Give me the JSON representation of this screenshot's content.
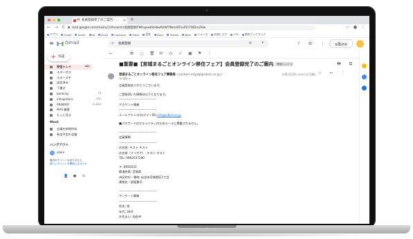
{
  "device": {
    "brand": "MacBook"
  },
  "browser": {
    "tab_title": "M: 会員登録完了のご案内 - ...",
    "tab_close": "×",
    "new_tab": "+",
    "nav_icons": "← → C",
    "url": "mail.google.com/mail/u/1/#search/会員登録/FMfcgxwKkHbwRhWTfNmzRFkxPZrTWDmZHw",
    "addr_icons": "☆ ● ⋮",
    "bookmarks": [
      "アプリ",
      "Gmail",
      "Gmail",
      "tw",
      "Drive",
      "Calendar",
      "Slack",
      "会社",
      "Docs",
      "Sheets",
      "Note",
      "ニュース",
      "お気に入り",
      "メモ",
      "他のブックマーク"
    ]
  },
  "gmail": {
    "menu_icon": "≡",
    "app_name": "Gmail",
    "search_value": "会員登録",
    "search_clear": "×",
    "search_options": "▾",
    "header_icons": "? ⚙ ⋮⋮⋮",
    "account": "sibire"
  },
  "sidebar": {
    "compose_label": "作成",
    "items": [
      {
        "label": "受信トレイ",
        "count": "481",
        "active": true
      },
      {
        "label": "スター付き",
        "count": ""
      },
      {
        "label": "スヌーズ中",
        "count": ""
      },
      {
        "label": "送信済み",
        "count": ""
      },
      {
        "label": "下書き",
        "count": ""
      },
      {
        "label": "banking",
        "count": "79"
      },
      {
        "label": "info@sibire",
        "count": "231"
      },
      {
        "label": "PRIMARY",
        "count": "11,624"
      },
      {
        "label": "MAS 顧客",
        "count": ""
      },
      {
        "label": "もっと見る",
        "count": ""
      }
    ],
    "meet_header": "Meet",
    "meet_items": [
      "会議を新規作成",
      "参加予定の会議"
    ],
    "hangouts_header": "ハングアウト",
    "hangouts_user": "sibire",
    "hangouts_note": "最近のチャットはありません",
    "hangouts_link": "新しいチャットを開始しませんか",
    "footer_icons": "👤 ● ☏"
  },
  "message": {
    "toolbar_icons": [
      "←",
      "⊠",
      "ⓘ",
      "🗑",
      "✉",
      "◷",
      "✓",
      "▣",
      "⚑",
      "⋮"
    ],
    "subject": "■重要■【宮城まるごとオンライン移住フェア】会員登録完了のご案内",
    "label_chip": "受信トレイ ×",
    "subject_icons": "🖶 ⧉",
    "sender_name": "宮城まるごとオンライン移住フェア事務局",
    "sender_email": "<system-miyagi@sibire.co.jp>",
    "to": "To 自分 ▾",
    "date": "12月7日(月) 14:02 (2 日前)",
    "date_icons": "☆ ↩ ⋮",
    "body_lines": [
      "会員登録ありがとうございます。",
      "",
      "ご登録頂いた情報は以下となります。",
      "------------------------------------",
      "アカウント情報",
      "------------------------------------",
      "メールアドレス(ログインID):",
      "",
      "■パスワードはセキュリティのためメールに掲載されません。",
      "",
      "------------------------------------",
      "会員情報",
      "------------------------------------",
      "お名前: テスト テスト",
      "お名前（フリガナ）: テスト テスト",
      "TEL: 0802037280",
      "",
      "〒: 8650033",
      "都道府県: 宮城県",
      "市区町村・番地: 仙台市宮城野区1丁目",
      "建物名・部屋番号:",
      "",
      "------------------------------------",
      "アンケート情報",
      "------------------------------------",
      "性別: 男",
      "年代: 30代",
      "お住まい: 仙台市"
    ],
    "email_link": "info@sibire.co.jp"
  },
  "colors": {
    "accent_red": "#ea4335",
    "link_blue": "#1a73e8",
    "active_bg": "#fce8e6"
  }
}
